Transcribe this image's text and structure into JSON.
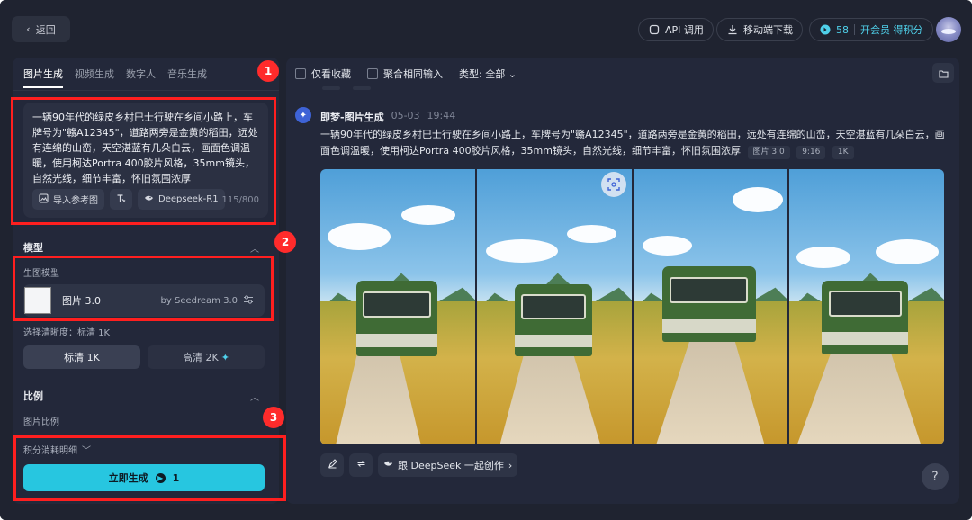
{
  "topbar": {
    "back_label": "返回",
    "api_label": "API 调用",
    "mobile_label": "移动端下载",
    "points": "58",
    "member_label": "开会员 得积分"
  },
  "left": {
    "tabs": [
      "图片生成",
      "视频生成",
      "数字人",
      "音乐生成"
    ],
    "prompt": "一辆90年代的绿皮乡村巴士行驶在乡间小路上，车牌号为\"赣A12345\"，道路两旁是金黄的稻田，远处有连绵的山峦，天空湛蓝有几朵白云，画面色调温暖，使用柯达Portra 400胶片风格，35mm镜头，自然光线，细节丰富，怀旧氛围浓厚",
    "tool_ref": "导入参考图",
    "tool_deepseek": "Deepseek-R1",
    "char_count": "115/800",
    "model_section": "模型",
    "model_sublabel": "生图模型",
    "model_name": "图片 3.0",
    "model_by": "by Seedream 3.0",
    "resolution_label": "选择清晰度：标清 1K",
    "res_1k": "标清 1K",
    "res_2k": "高清 2K",
    "ratio_section": "比例",
    "ratio_sublabel": "图片比例",
    "cost_label": "积分消耗明细",
    "generate_label": "立即生成",
    "generate_cost": "1"
  },
  "right": {
    "filter_fav": "仅看收藏",
    "filter_merge": "聚合相同输入",
    "filter_type": "类型: 全部",
    "msg_name": "即梦-图片生成",
    "msg_date": "05-03",
    "msg_time": "19:44",
    "msg_text": "一辆90年代的绿皮乡村巴士行驶在乡间小路上，车牌号为\"赣A12345\"，道路两旁是金黄的稻田，远处有连绵的山峦，天空湛蓝有几朵白云，画面色调温暖，使用柯达Portra 400胶片风格，35mm镜头，自然光线，细节丰富，怀旧氛围浓厚",
    "tags": [
      "图片 3.0",
      "9:16",
      "1K"
    ],
    "deepseek_action": "跟 DeepSeek 一起创作",
    "help_label": "?"
  },
  "annotations": [
    "1",
    "2",
    "3"
  ],
  "colors": {
    "accent": "#27c6e0",
    "highlight": "#ff1f1f",
    "panel": "#23283a"
  }
}
